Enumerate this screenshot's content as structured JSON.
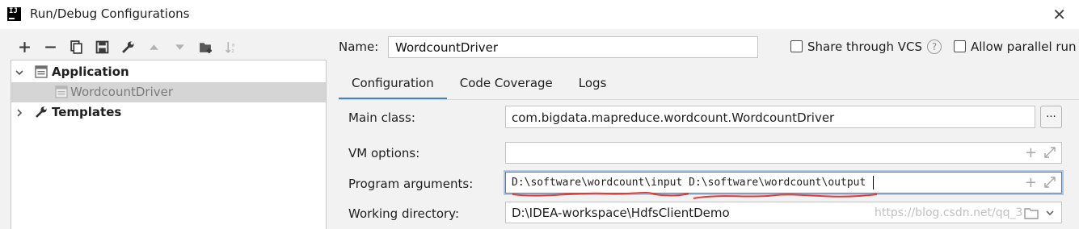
{
  "window": {
    "title": "Run/Debug Configurations"
  },
  "colors": {
    "accent": "#4083c9",
    "selection": "#d5d5d5",
    "annotation": "#e53935"
  },
  "toolbar": {
    "icons": [
      "plus-icon",
      "minus-icon",
      "copy-icon",
      "save-icon",
      "wrench-icon",
      "arrow-up-icon",
      "arrow-down-icon",
      "folder-plus-icon",
      "sort-az-icon"
    ]
  },
  "tree": {
    "application": "Application",
    "wordcount": "WordcountDriver",
    "templates": "Templates"
  },
  "name_field": {
    "label": "Name:",
    "value": "WordcountDriver"
  },
  "share_vcs": {
    "label": "Share through VCS",
    "checked": false
  },
  "allow_parallel": {
    "label": "Allow parallel run",
    "checked": false
  },
  "help": "?",
  "tabs": [
    "Configuration",
    "Code Coverage",
    "Logs"
  ],
  "form": {
    "main_class": {
      "label": "Main class:",
      "value": "com.bigdata.mapreduce.wordcount.WordcountDriver",
      "button": "..."
    },
    "vm_options": {
      "label": "VM options:",
      "value": ""
    },
    "program_arguments": {
      "label": "Program arguments:",
      "value": "D:\\software\\wordcount\\input D:\\software\\wordcount\\output"
    },
    "working_directory": {
      "label": "Working directory:",
      "value": "D:\\IDEA-workspace\\HdfsClientDemo"
    }
  },
  "watermark": "https://blog.csdn.net/qq_3"
}
